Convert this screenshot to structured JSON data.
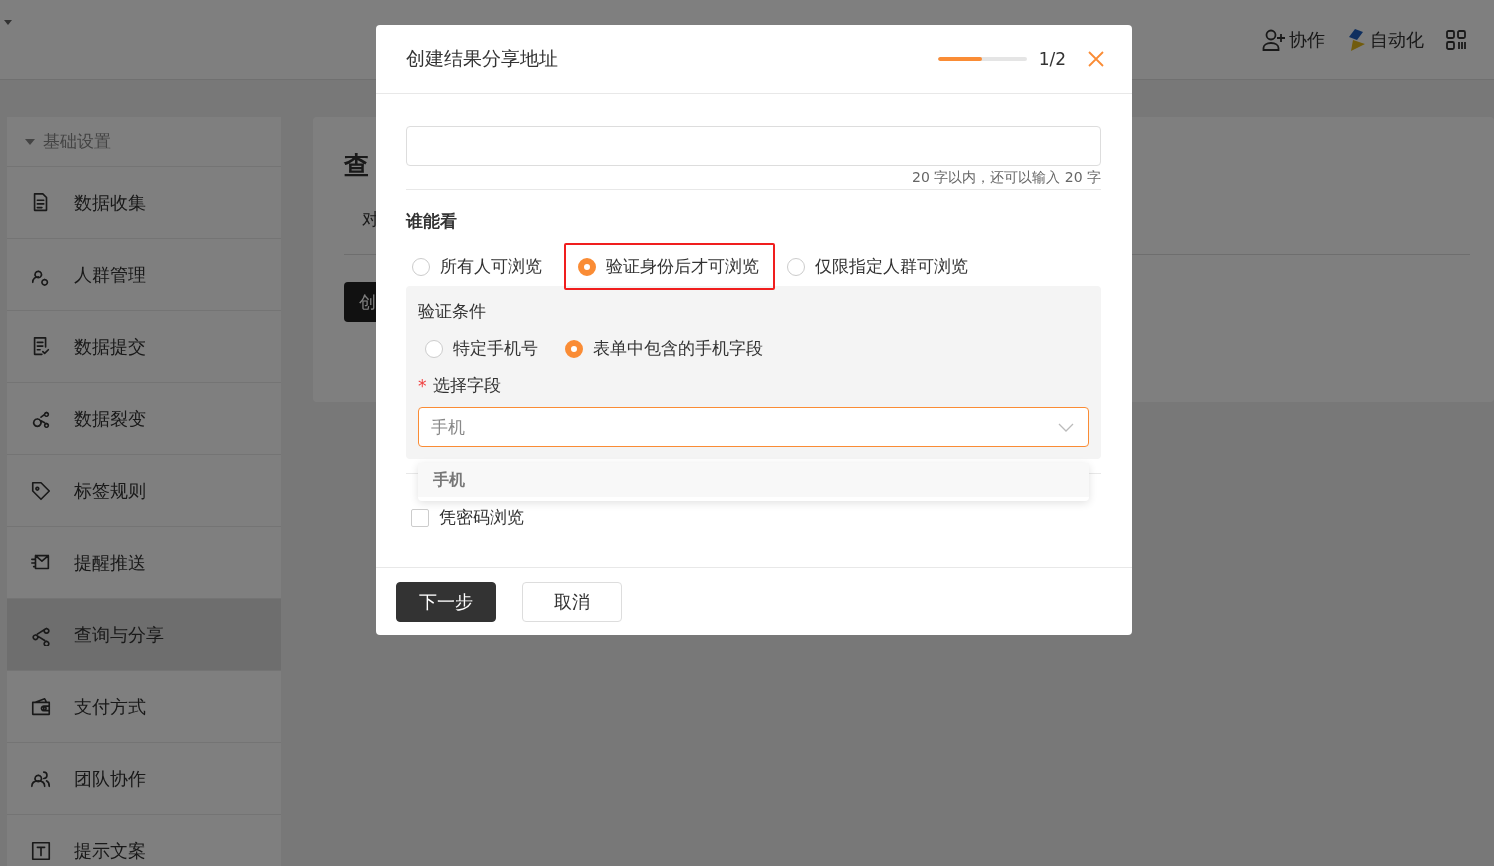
{
  "header": {
    "items": [
      {
        "label": "协作",
        "kind": "collab"
      },
      {
        "label": "自动化",
        "kind": "automation"
      }
    ]
  },
  "sidebar": {
    "group": {
      "label": "基础设置",
      "expanded": true
    },
    "items": [
      {
        "label": "数据收集",
        "selected": false
      },
      {
        "label": "人群管理",
        "selected": false
      },
      {
        "label": "数据提交",
        "selected": false
      },
      {
        "label": "数据裂变",
        "selected": false
      },
      {
        "label": "标签规则",
        "selected": false
      },
      {
        "label": "提醒推送",
        "selected": false
      },
      {
        "label": "查询与分享",
        "selected": true
      },
      {
        "label": "支付方式",
        "selected": false
      },
      {
        "label": "团队协作",
        "selected": false
      },
      {
        "label": "提示文案",
        "selected": false
      }
    ]
  },
  "content": {
    "title": "查",
    "tab": "对",
    "button": "创"
  },
  "dialog": {
    "title": "创建结果分享地址",
    "step": {
      "level": 0.5,
      "text": "1/2"
    },
    "counter": "20 字以内，还可以输入 20 字",
    "who_label": "谁能看",
    "visibility_options": [
      {
        "label": "所有人可浏览",
        "selected": false,
        "highlighted": false
      },
      {
        "label": "验证身份后才可浏览",
        "selected": true,
        "highlighted": true
      },
      {
        "label": "仅限指定人群可浏览",
        "selected": false,
        "highlighted": false
      }
    ],
    "verify": {
      "label": "验证条件",
      "methods": [
        {
          "label": "特定手机号",
          "selected": false
        },
        {
          "label": "表单中包含的手机字段",
          "selected": true
        }
      ],
      "field_label": "选择字段",
      "required_mark": "*",
      "select": {
        "value": "手机",
        "focused": true
      },
      "options": [
        {
          "label": "手机"
        }
      ]
    },
    "password": {
      "label": "凭密码浏览",
      "checked": false
    },
    "buttons": [
      {
        "label": "下一步",
        "kind": "primary"
      },
      {
        "label": "取消",
        "kind": "default"
      }
    ]
  }
}
